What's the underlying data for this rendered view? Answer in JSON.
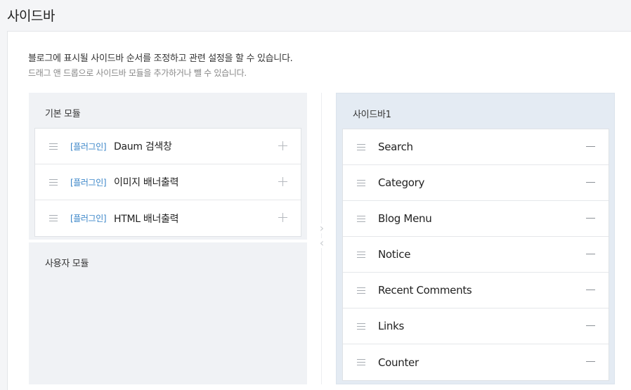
{
  "page": {
    "title": "사이드바"
  },
  "description": {
    "main": "블로그에 표시될 사이드바 순서를 조정하고 관련 설정을 할 수 있습니다.",
    "sub": "드래그 앤 드롭으로 사이드바 모듈을 추가하거나 뺄 수 있습니다."
  },
  "basic_modules": {
    "heading": "기본 모듈",
    "items": [
      {
        "tag": "[플러그인]",
        "label": "Daum 검색창",
        "action_icon": "plus-icon"
      },
      {
        "tag": "[플러그인]",
        "label": "이미지 배너출력",
        "action_icon": "plus-icon"
      },
      {
        "tag": "[플러그인]",
        "label": "HTML 배너출력",
        "action_icon": "plus-icon"
      }
    ]
  },
  "user_modules": {
    "heading": "사용자 모듈",
    "items": []
  },
  "sidebar1": {
    "heading": "사이드바1",
    "items": [
      {
        "label": "Search",
        "action_icon": "minus-icon"
      },
      {
        "label": "Category",
        "action_icon": "minus-icon"
      },
      {
        "label": "Blog Menu",
        "action_icon": "minus-icon"
      },
      {
        "label": "Notice",
        "action_icon": "minus-icon"
      },
      {
        "label": "Recent Comments",
        "action_icon": "minus-icon"
      },
      {
        "label": "Links",
        "action_icon": "minus-icon"
      },
      {
        "label": "Counter",
        "action_icon": "minus-icon"
      }
    ]
  },
  "colors": {
    "tag_blue": "#3a85c8",
    "module_box_bg": "#f0f2f5",
    "sidebar_box_bg": "#e4ebf3"
  }
}
